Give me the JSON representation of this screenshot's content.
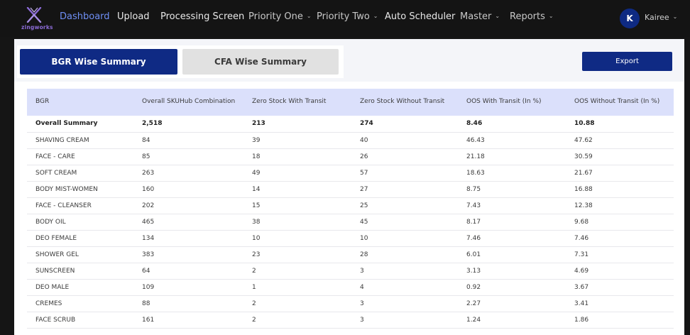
{
  "nav": {
    "logo_text": "zingworks",
    "items": [
      {
        "label": "Dashboard",
        "dropdown": false,
        "active": true
      },
      {
        "label": "Upload",
        "dropdown": false,
        "active": false
      },
      {
        "label": "Processing Screen",
        "dropdown": false,
        "active": false
      },
      {
        "label": "Priority One",
        "dropdown": true,
        "active": false
      },
      {
        "label": "Priority Two",
        "dropdown": true,
        "active": false
      },
      {
        "label": "Auto Scheduler",
        "dropdown": false,
        "active": false
      },
      {
        "label": "Master",
        "dropdown": true,
        "active": false
      },
      {
        "label": "Reports",
        "dropdown": true,
        "active": false
      }
    ],
    "user": {
      "initial": "K",
      "name": "Kairee"
    }
  },
  "tabs": {
    "bgr": "BGR Wise Summary",
    "cfa": "CFA Wise Summary"
  },
  "export_label": "Export",
  "table": {
    "headers": [
      "BGR",
      "Overall SKUHub Combination",
      "Zero Stock With Transit",
      "Zero Stock Without Transit",
      "OOS With Transit (In %)",
      "OOS Without Transit (In %)"
    ],
    "summary": [
      "Overall Summary",
      "2,518",
      "213",
      "274",
      "8.46",
      "10.88"
    ],
    "rows": [
      [
        "SHAVING CREAM",
        "84",
        "39",
        "40",
        "46.43",
        "47.62"
      ],
      [
        "FACE - CARE",
        "85",
        "18",
        "26",
        "21.18",
        "30.59"
      ],
      [
        "SOFT CREAM",
        "263",
        "49",
        "57",
        "18.63",
        "21.67"
      ],
      [
        "BODY MIST-WOMEN",
        "160",
        "14",
        "27",
        "8.75",
        "16.88"
      ],
      [
        "FACE - CLEANSER",
        "202",
        "15",
        "25",
        "7.43",
        "12.38"
      ],
      [
        "BODY OIL",
        "465",
        "38",
        "45",
        "8.17",
        "9.68"
      ],
      [
        "DEO FEMALE",
        "134",
        "10",
        "10",
        "7.46",
        "7.46"
      ],
      [
        "SHOWER GEL",
        "383",
        "23",
        "28",
        "6.01",
        "7.31"
      ],
      [
        "SUNSCREEN",
        "64",
        "2",
        "3",
        "3.13",
        "4.69"
      ],
      [
        "DEO MALE",
        "109",
        "1",
        "4",
        "0.92",
        "3.67"
      ],
      [
        "CREMES",
        "88",
        "2",
        "3",
        "2.27",
        "3.41"
      ],
      [
        "FACE SCRUB",
        "161",
        "2",
        "3",
        "1.24",
        "1.86"
      ]
    ]
  },
  "colors": {
    "accent": "#0f2a84",
    "active_nav": "#6f8ff5",
    "header_row": "#dbe0fb",
    "logo": "#8b6bd6"
  }
}
